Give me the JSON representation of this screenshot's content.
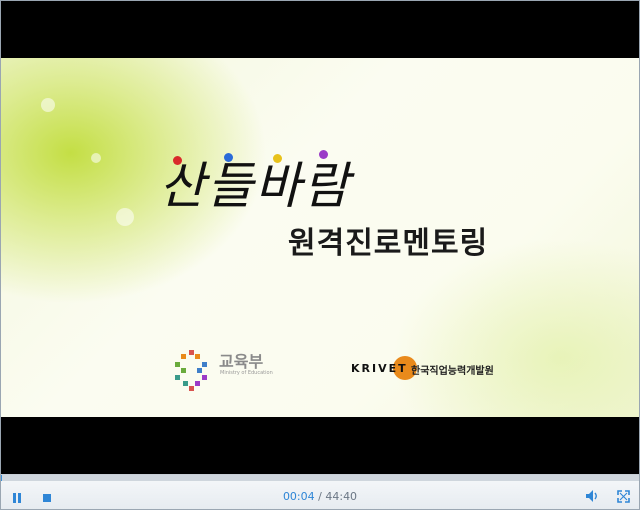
{
  "video": {
    "title_main": "산들바람",
    "title_sub": "원격진로멘토링",
    "logos": {
      "ministry_name": "교육부",
      "ministry_sub": "Ministry of Education",
      "institute_abbr": "KRIVET",
      "institute_name": "한국직업능력개발원"
    }
  },
  "controls": {
    "current_time": "00:04",
    "separator": "/",
    "total_time": "44:40",
    "progress_fraction": 0.0015,
    "icons": {
      "play_pause": "pause-icon",
      "stop": "stop-icon",
      "volume": "volume-icon",
      "fullscreen": "fullscreen-icon"
    },
    "accent": "#2f86d6"
  }
}
